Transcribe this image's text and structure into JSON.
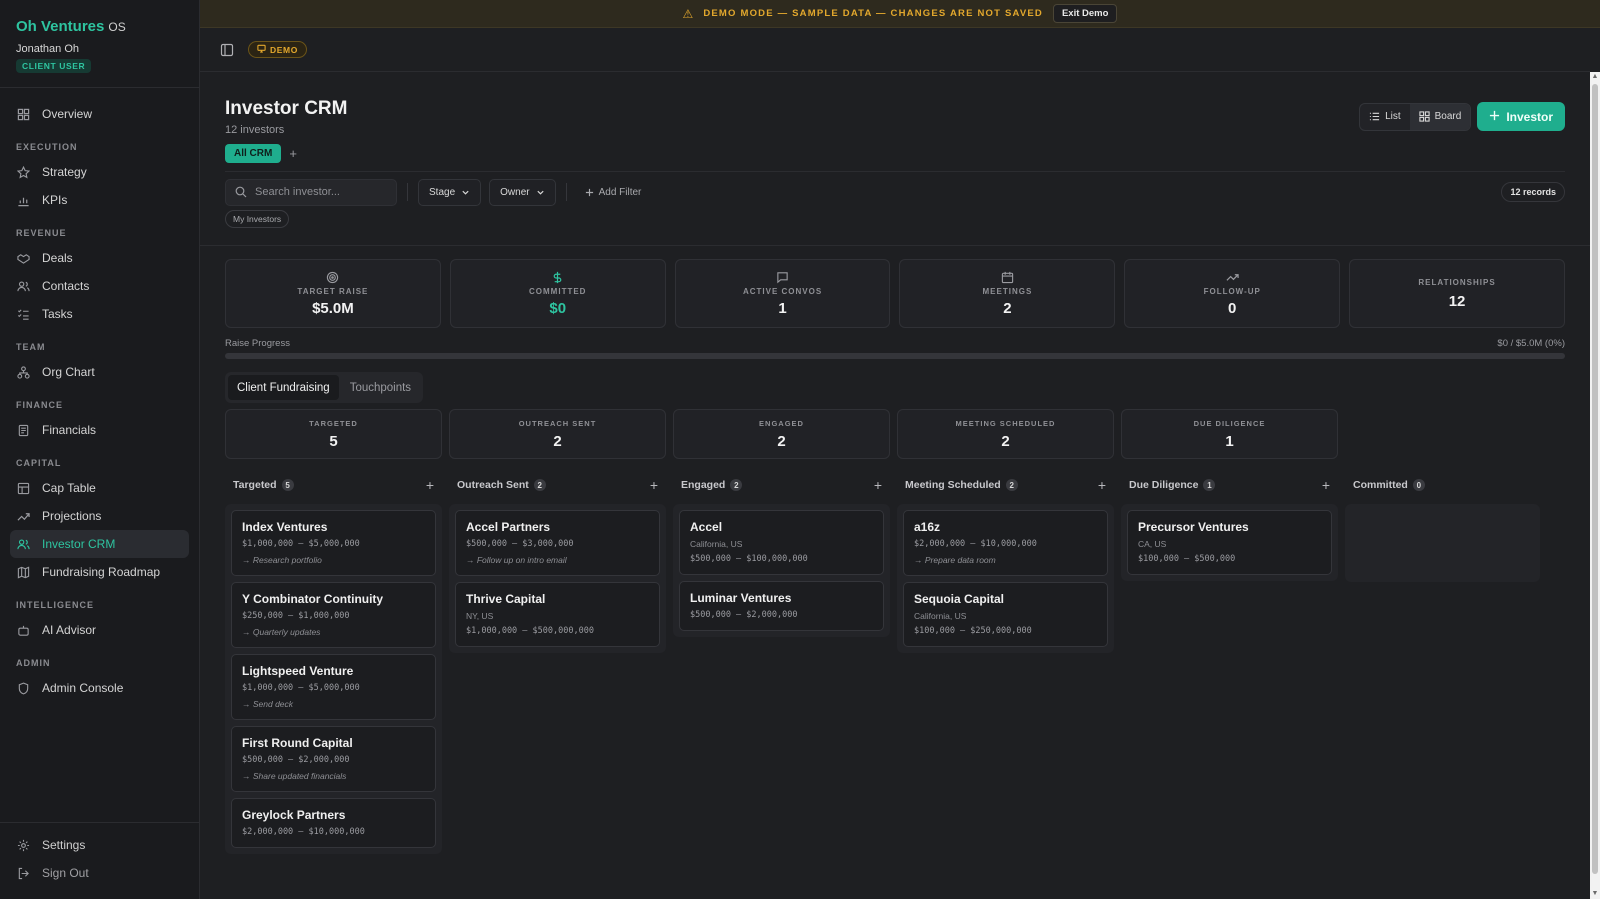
{
  "brand": {
    "name": "Oh Ventures",
    "suffix": "OS"
  },
  "user": {
    "name": "Jonathan Oh",
    "role": "CLIENT USER"
  },
  "nav": {
    "overview": "Overview",
    "sections": {
      "execution": "EXECUTION",
      "revenue": "REVENUE",
      "team": "TEAM",
      "finance": "FINANCE",
      "capital": "CAPITAL",
      "intelligence": "INTELLIGENCE",
      "admin": "ADMIN"
    },
    "items": {
      "strategy": "Strategy",
      "kpis": "KPIs",
      "deals": "Deals",
      "contacts": "Contacts",
      "tasks": "Tasks",
      "org_chart": "Org Chart",
      "financials": "Financials",
      "cap_table": "Cap Table",
      "projections": "Projections",
      "investor_crm": "Investor CRM",
      "fundraising_roadmap": "Fundraising Roadmap",
      "ai_advisor": "AI Advisor",
      "admin_console": "Admin Console"
    },
    "footer": {
      "settings": "Settings",
      "sign_out": "Sign Out"
    }
  },
  "banner": {
    "text": "DEMO MODE — SAMPLE DATA — CHANGES ARE NOT SAVED",
    "exit_label": "Exit Demo"
  },
  "topbar": {
    "demo_label": "DEMO"
  },
  "page": {
    "title": "Investor CRM",
    "subtitle": "12 investors",
    "view_tab": "All CRM",
    "add_view": "+",
    "list_label": "List",
    "board_label": "Board",
    "add_investor_label": "Investor"
  },
  "filters": {
    "search_placeholder": "Search investor...",
    "stage_label": "Stage",
    "owner_label": "Owner",
    "add_filter_label": "Add Filter",
    "records_label": "12 records",
    "my_investors_label": "My Investors"
  },
  "stats": [
    {
      "label": "TARGET RAISE",
      "value": "$5.0M",
      "icon": "target-icon"
    },
    {
      "label": "COMMITTED",
      "value": "$0",
      "icon": "dollar-icon"
    },
    {
      "label": "ACTIVE CONVOS",
      "value": "1",
      "icon": "message-icon"
    },
    {
      "label": "MEETINGS",
      "value": "2",
      "icon": "calendar-icon"
    },
    {
      "label": "FOLLOW-UP",
      "value": "0",
      "icon": "trending-icon"
    },
    {
      "label": "RELATIONSHIPS",
      "value": "12"
    }
  ],
  "progress": {
    "label": "Raise Progress",
    "summary": "$0 / $5.0M (0%)",
    "fraction": 0
  },
  "subtabs": {
    "client_fundraising": "Client Fundraising",
    "touchpoints": "Touchpoints"
  },
  "stage_summary": [
    {
      "label": "TARGETED",
      "value": "5"
    },
    {
      "label": "OUTREACH SENT",
      "value": "2"
    },
    {
      "label": "ENGAGED",
      "value": "2"
    },
    {
      "label": "MEETING SCHEDULED",
      "value": "2"
    },
    {
      "label": "DUE DILIGENCE",
      "value": "1"
    }
  ],
  "columns": [
    {
      "title": "Targeted",
      "count": "5"
    },
    {
      "title": "Outreach Sent",
      "count": "2"
    },
    {
      "title": "Engaged",
      "count": "2"
    },
    {
      "title": "Meeting Scheduled",
      "count": "2"
    },
    {
      "title": "Due Diligence",
      "count": "1"
    },
    {
      "title": "Committed",
      "count": "0"
    }
  ],
  "cards": {
    "targeted": [
      {
        "name": "Index Ventures",
        "range": "$1,000,000 – $5,000,000",
        "task": "→ Research portfolio"
      },
      {
        "name": "Y Combinator Continuity",
        "range": "$250,000 – $1,000,000",
        "task": "→ Quarterly updates"
      },
      {
        "name": "Lightspeed Venture",
        "range": "$1,000,000 – $5,000,000",
        "task": "→ Send deck"
      },
      {
        "name": "First Round Capital",
        "range": "$500,000 – $2,000,000",
        "task": "→ Share updated financials"
      },
      {
        "name": "Greylock Partners",
        "range": "$2,000,000 – $10,000,000"
      }
    ],
    "outreach": [
      {
        "name": "Accel Partners",
        "range": "$500,000 – $3,000,000",
        "task": "→ Follow up on intro email"
      },
      {
        "name": "Thrive Capital",
        "location": "NY, US",
        "range": "$1,000,000 – $500,000,000"
      }
    ],
    "engaged": [
      {
        "name": "Accel",
        "location": "California, US",
        "range": "$500,000 – $100,000,000"
      },
      {
        "name": "Luminar Ventures",
        "range": "$500,000 – $2,000,000"
      }
    ],
    "meeting": [
      {
        "name": "a16z",
        "range": "$2,000,000 – $10,000,000",
        "task": "→ Prepare data room"
      },
      {
        "name": "Sequoia Capital",
        "location": "California, US",
        "range": "$100,000 – $250,000,000"
      }
    ],
    "diligence": [
      {
        "name": "Precursor Ventures",
        "location": "CA, US",
        "range": "$100,000 – $500,000"
      }
    ]
  },
  "colors": {
    "accent": "#1fae8e",
    "accent_text": "#2ec4a0",
    "warning": "#e3a82d",
    "background": "#1e1f22"
  }
}
